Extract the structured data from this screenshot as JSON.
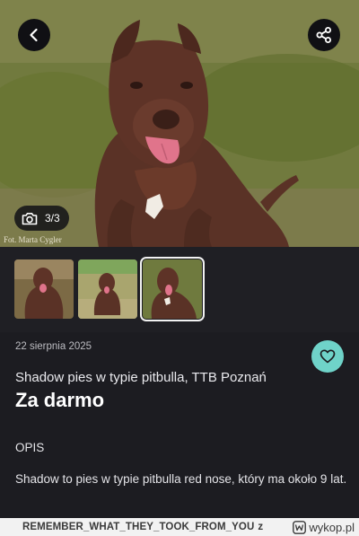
{
  "gallery": {
    "counter": "3/3",
    "photo_credit": "Fot. Marta Cygler",
    "thumbnail_count": 3,
    "selected_thumbnail": 3
  },
  "listing": {
    "date": "22 sierpnia 2025",
    "title": "Shadow pies w typie pitbulla, TTB Poznań",
    "price": "Za darmo",
    "description_heading": "OPIS",
    "description": "Shadow to pies w typie pitbulla red nose, który ma około 9 lat."
  },
  "footer": {
    "username": "REMEMBER_WHAT_THEY_TOOK_FROM_YOU",
    "username_suffix": "z",
    "site": "wykop.pl"
  },
  "colors": {
    "accent": "#6fd3c9",
    "background": "#1c1c21"
  },
  "icons": {
    "back": "chevron-left-icon",
    "share": "share-icon",
    "camera": "camera-icon",
    "favorite": "heart-icon",
    "site_logo": "wykop-logo-icon"
  }
}
